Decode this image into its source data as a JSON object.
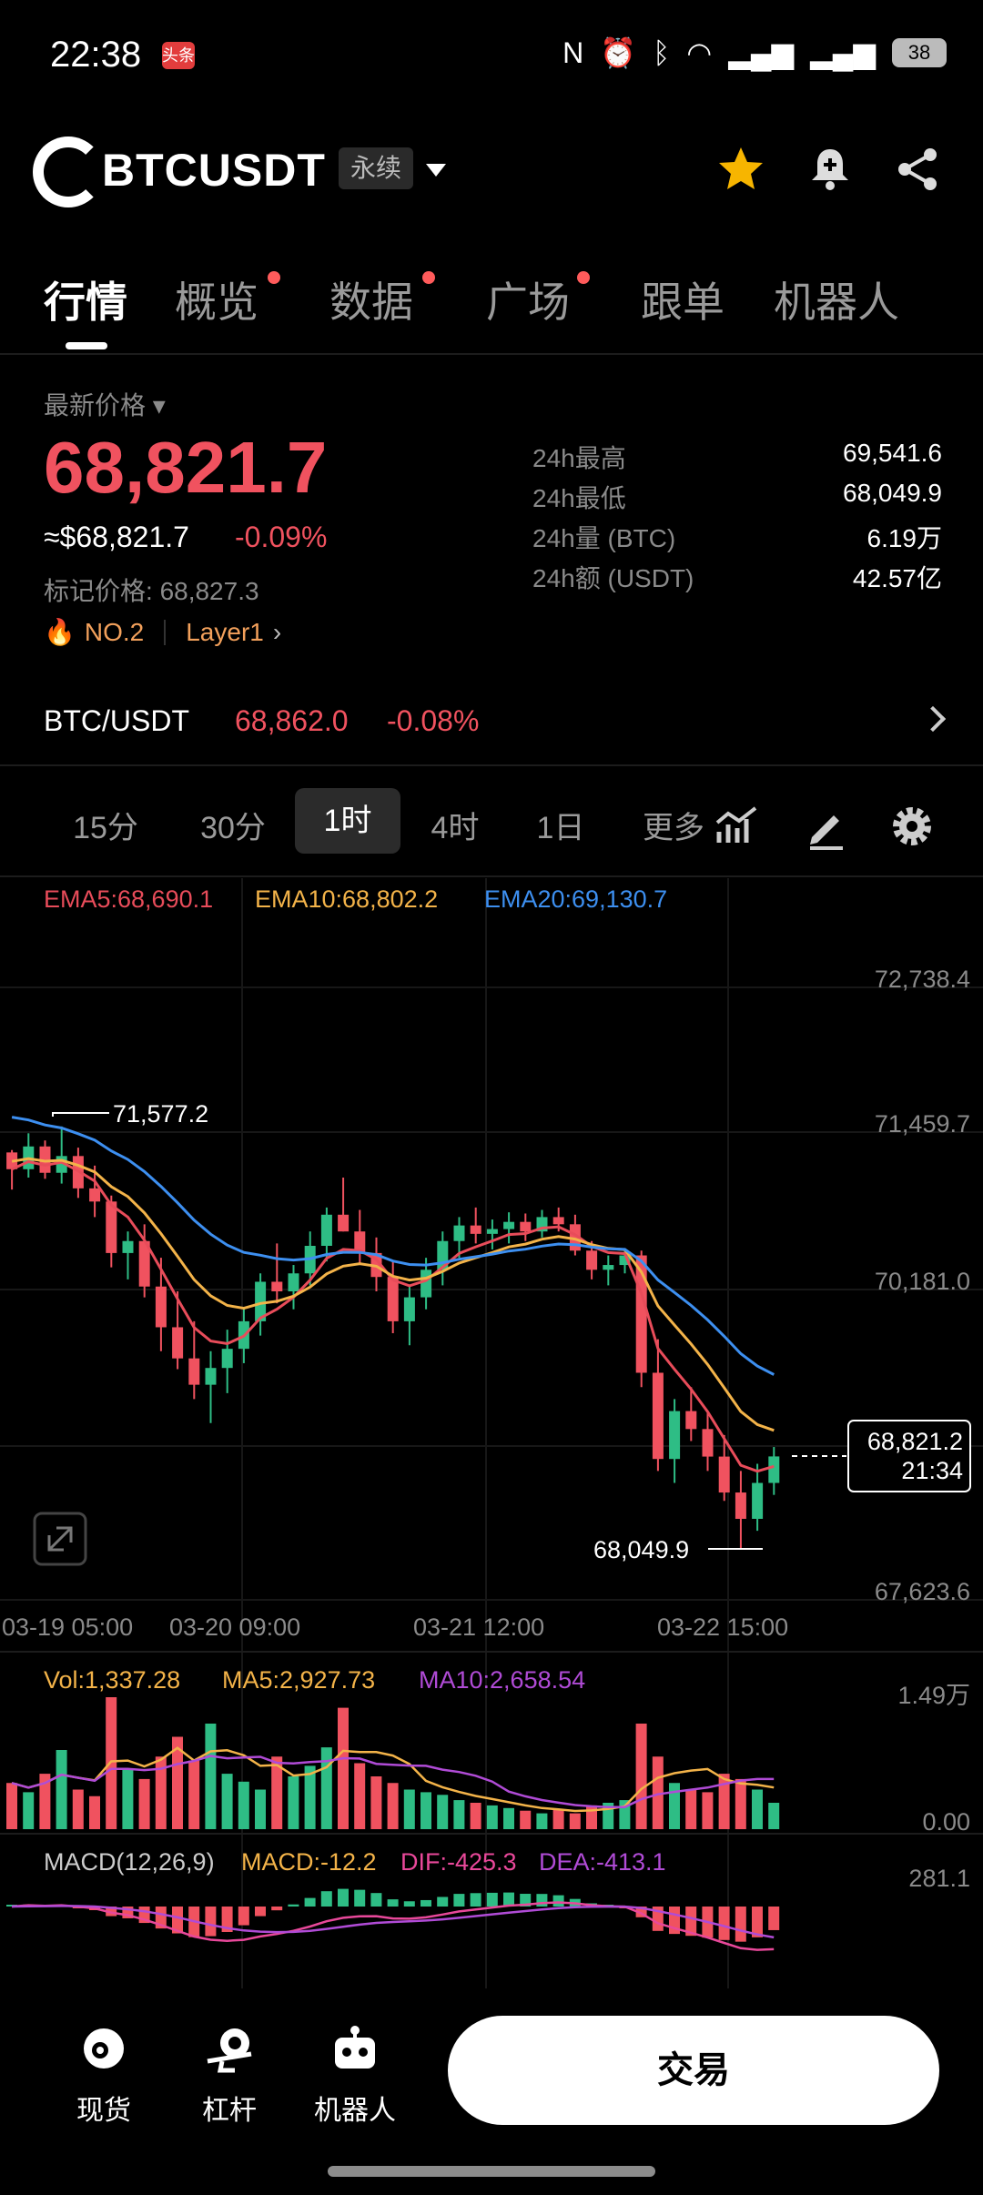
{
  "status_bar": {
    "time": "22:38",
    "app_badge": "头条",
    "icons": [
      "nfc-icon",
      "alarm-icon",
      "bluetooth-icon",
      "wifi-icon",
      "signal-4g-icon",
      "signal-5g-icon"
    ],
    "battery": "38"
  },
  "header": {
    "symbol": "BTCUSDT",
    "contract_type": "永续"
  },
  "tabs": [
    {
      "label": "行情",
      "active": true,
      "dot": false
    },
    {
      "label": "概览",
      "active": false,
      "dot": true
    },
    {
      "label": "数据",
      "active": false,
      "dot": true
    },
    {
      "label": "广场",
      "active": false,
      "dot": true
    },
    {
      "label": "跟单",
      "active": false,
      "dot": false
    },
    {
      "label": "机器人",
      "active": false,
      "dot": false
    }
  ],
  "price": {
    "label": "最新价格",
    "last": "68,821.7",
    "usd": "≈$68,821.7",
    "change": "-0.09%",
    "mark_label": "标记价格:",
    "mark_value": "68,827.3",
    "rank": "NO.2",
    "sector": "Layer1"
  },
  "stats": [
    {
      "label": "24h最高",
      "value": "69,541.6"
    },
    {
      "label": "24h最低",
      "value": "68,049.9"
    },
    {
      "label": "24h量 (BTC)",
      "value": "6.19万"
    },
    {
      "label": "24h额 (USDT)",
      "value": "42.57亿"
    }
  ],
  "spot": {
    "pair": "BTC/USDT",
    "price": "68,862.0",
    "change": "-0.08%"
  },
  "intervals": [
    {
      "label": "15分",
      "active": false
    },
    {
      "label": "30分",
      "active": false
    },
    {
      "label": "1时",
      "active": true
    },
    {
      "label": "4时",
      "active": false
    },
    {
      "label": "1日",
      "active": false
    },
    {
      "label": "更多",
      "active": false
    }
  ],
  "chart_data": {
    "type": "candlestick",
    "indicators": {
      "ema5": "EMA5:68,690.1",
      "ema10": "EMA10:68,802.2",
      "ema20": "EMA20:69,130.7"
    },
    "y_ticks": [
      "72,738.4",
      "71,459.7",
      "70,181.0",
      "67,623.6"
    ],
    "ylim": [
      67623.6,
      72738.4
    ],
    "x_ticks": [
      "03-19 05:00",
      "03-20 09:00",
      "03-21 12:00",
      "03-22 15:00"
    ],
    "high_marker": "71,577.2",
    "low_marker": "68,049.9",
    "current_price": "68,821.2",
    "countdown": "21:34",
    "candles": [
      [
        71360,
        71380,
        71050,
        71220
      ],
      [
        71220,
        71520,
        71150,
        71410
      ],
      [
        71410,
        71460,
        71140,
        71190
      ],
      [
        71190,
        71577,
        71100,
        71330
      ],
      [
        71330,
        71400,
        70980,
        71060
      ],
      [
        71060,
        71250,
        70820,
        70950
      ],
      [
        70950,
        71000,
        70400,
        70520
      ],
      [
        70520,
        70700,
        70300,
        70620
      ],
      [
        70620,
        70760,
        70150,
        70240
      ],
      [
        70240,
        70480,
        69700,
        69900
      ],
      [
        69900,
        70200,
        69550,
        69640
      ],
      [
        69640,
        69950,
        69300,
        69420
      ],
      [
        69420,
        69700,
        69100,
        69560
      ],
      [
        69560,
        69880,
        69350,
        69720
      ],
      [
        69720,
        70050,
        69600,
        69950
      ],
      [
        69950,
        70350,
        69830,
        70280
      ],
      [
        70280,
        70600,
        70100,
        70200
      ],
      [
        70200,
        70420,
        70050,
        70350
      ],
      [
        70350,
        70700,
        70250,
        70580
      ],
      [
        70580,
        70900,
        70450,
        70840
      ],
      [
        70840,
        71150,
        70700,
        70700
      ],
      [
        70700,
        70880,
        70420,
        70520
      ],
      [
        70520,
        70650,
        70200,
        70320
      ],
      [
        70320,
        70460,
        69850,
        69950
      ],
      [
        69950,
        70250,
        69750,
        70150
      ],
      [
        70150,
        70480,
        70050,
        70380
      ],
      [
        70380,
        70700,
        70250,
        70620
      ],
      [
        70620,
        70820,
        70480,
        70750
      ],
      [
        70750,
        70900,
        70600,
        70680
      ],
      [
        70680,
        70800,
        70550,
        70720
      ],
      [
        70720,
        70860,
        70600,
        70780
      ],
      [
        70780,
        70850,
        70620,
        70700
      ],
      [
        70700,
        70880,
        70650,
        70820
      ],
      [
        70820,
        70900,
        70700,
        70760
      ],
      [
        70760,
        70840,
        70500,
        70540
      ],
      [
        70540,
        70620,
        70300,
        70380
      ],
      [
        70380,
        70500,
        70250,
        70420
      ],
      [
        70420,
        70560,
        70350,
        70500
      ],
      [
        70500,
        70540,
        69400,
        69520
      ],
      [
        69520,
        69800,
        68700,
        68800
      ],
      [
        68800,
        69300,
        68600,
        69200
      ],
      [
        69200,
        69400,
        68950,
        69050
      ],
      [
        69050,
        69200,
        68700,
        68820
      ],
      [
        68820,
        69000,
        68450,
        68520
      ],
      [
        68520,
        68700,
        68049.9,
        68300
      ],
      [
        68300,
        68760,
        68200,
        68600
      ],
      [
        68600,
        68900,
        68500,
        68821.2
      ]
    ]
  },
  "volume_panel": {
    "vol": "Vol:1,337.28",
    "ma5": "MA5:2,927.73",
    "ma10": "MA10:2,658.54",
    "y_ticks": [
      "1.49万",
      "0.00"
    ],
    "bars": [
      0.35,
      0.28,
      0.42,
      0.6,
      0.3,
      0.25,
      1.0,
      0.45,
      0.38,
      0.55,
      0.7,
      0.52,
      0.8,
      0.42,
      0.36,
      0.3,
      0.55,
      0.4,
      0.48,
      0.62,
      0.92,
      0.5,
      0.4,
      0.35,
      0.3,
      0.28,
      0.26,
      0.22,
      0.2,
      0.18,
      0.16,
      0.14,
      0.12,
      0.15,
      0.12,
      0.18,
      0.2,
      0.22,
      0.8,
      0.55,
      0.35,
      0.3,
      0.28,
      0.42,
      0.38,
      0.3,
      0.2
    ]
  },
  "macd_panel": {
    "title": "MACD(12,26,9)",
    "macd": "MACD:-12.2",
    "dif": "DIF:-425.3",
    "dea": "DEA:-413.1",
    "y_tick": "281.1"
  },
  "bottom_nav": [
    {
      "label": "现货",
      "icon": "spot-icon"
    },
    {
      "label": "杠杆",
      "icon": "margin-icon"
    },
    {
      "label": "机器人",
      "icon": "robot-icon"
    }
  ],
  "trade_button": "交易",
  "colors": {
    "up": "#2ebd85",
    "down": "#f0525f",
    "ema5": "#e84c5a",
    "ema10": "#f3b349",
    "ema20": "#3d8ff0",
    "ma10": "#b04bd6"
  }
}
